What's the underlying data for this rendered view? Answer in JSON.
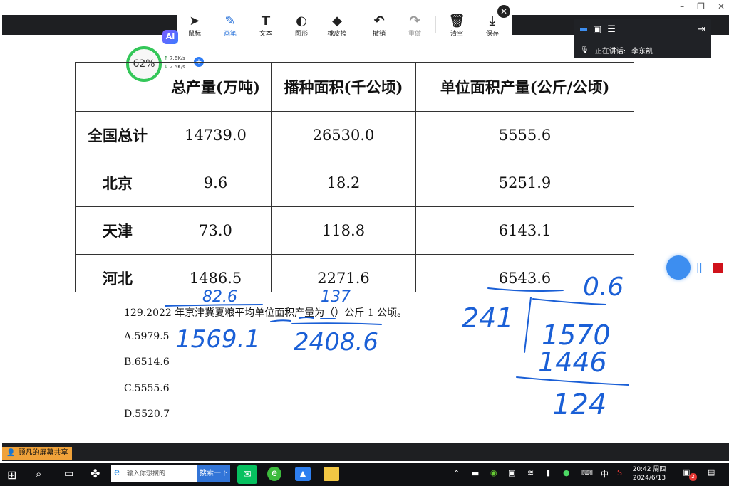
{
  "window": {
    "minimize": "–",
    "restore": "❐",
    "close": "✕"
  },
  "toolbar": {
    "items": [
      {
        "label": "鼠标",
        "icon": "cursor-icon",
        "glyph": "➤"
      },
      {
        "label": "画笔",
        "icon": "pen-icon",
        "glyph": "✎"
      },
      {
        "label": "文本",
        "icon": "text-icon",
        "glyph": "T"
      },
      {
        "label": "图形",
        "icon": "shape-icon",
        "glyph": "◐"
      },
      {
        "label": "橡皮擦",
        "icon": "eraser-icon",
        "glyph": "◆"
      },
      {
        "label": "撤销",
        "icon": "undo-icon",
        "glyph": "↶"
      },
      {
        "label": "重做",
        "icon": "redo-icon",
        "glyph": "↷"
      },
      {
        "label": "清空",
        "icon": "trash-icon",
        "glyph": "🗑"
      },
      {
        "label": "保存",
        "icon": "download-icon",
        "glyph": "⤓"
      }
    ],
    "close": "✕"
  },
  "speaker": {
    "status": "正在讲话:",
    "name": "李东凯"
  },
  "ai_badge": "AI",
  "network": {
    "percent": "62%",
    "up": "7.6K/s",
    "down": "2.5K/s"
  },
  "table": {
    "headers": [
      "",
      "总产量(万吨)",
      "播种面积(千公顷)",
      "单位面积产量(公斤/公顷)"
    ],
    "rows": [
      {
        "region": "全国总计",
        "total": "14739.0",
        "area": "26530.0",
        "yield": "5555.6"
      },
      {
        "region": "北京",
        "total": "9.6",
        "area": "18.2",
        "yield": "5251.9"
      },
      {
        "region": "天津",
        "total": "73.0",
        "area": "118.8",
        "yield": "6143.1"
      },
      {
        "region": "河北",
        "total": "1486.5",
        "area": "2271.6",
        "yield": "6543.6"
      }
    ]
  },
  "question": {
    "text": "129.2022 年京津冀夏粮平均单位面积产量为（）公斤 1 公顷。",
    "options": [
      "A.5979.5",
      "B.6514.6",
      "C.5555.6",
      "D.5520.7"
    ]
  },
  "handwriting": {
    "sum_total_partial": "82.6",
    "sum_total": "1569.1",
    "sum_area_partial": "137",
    "sum_area": "2408.6",
    "quotient": "0.6",
    "divisor": "241",
    "dividend": "1570",
    "product": "1446",
    "remainder": "124"
  },
  "share": {
    "label": "顾凡的屏幕共享"
  },
  "taskbar": {
    "search_placeholder": "输入你想搜的",
    "search_button": "搜索一下",
    "time": "20:42 周四",
    "date": "2024/6/13",
    "ime": "中",
    "badge": "2"
  },
  "colors": {
    "ink": "#1a5fd6",
    "accent": "#1d6bd8",
    "bar": "#1e1f22",
    "progress": "#34c759"
  }
}
